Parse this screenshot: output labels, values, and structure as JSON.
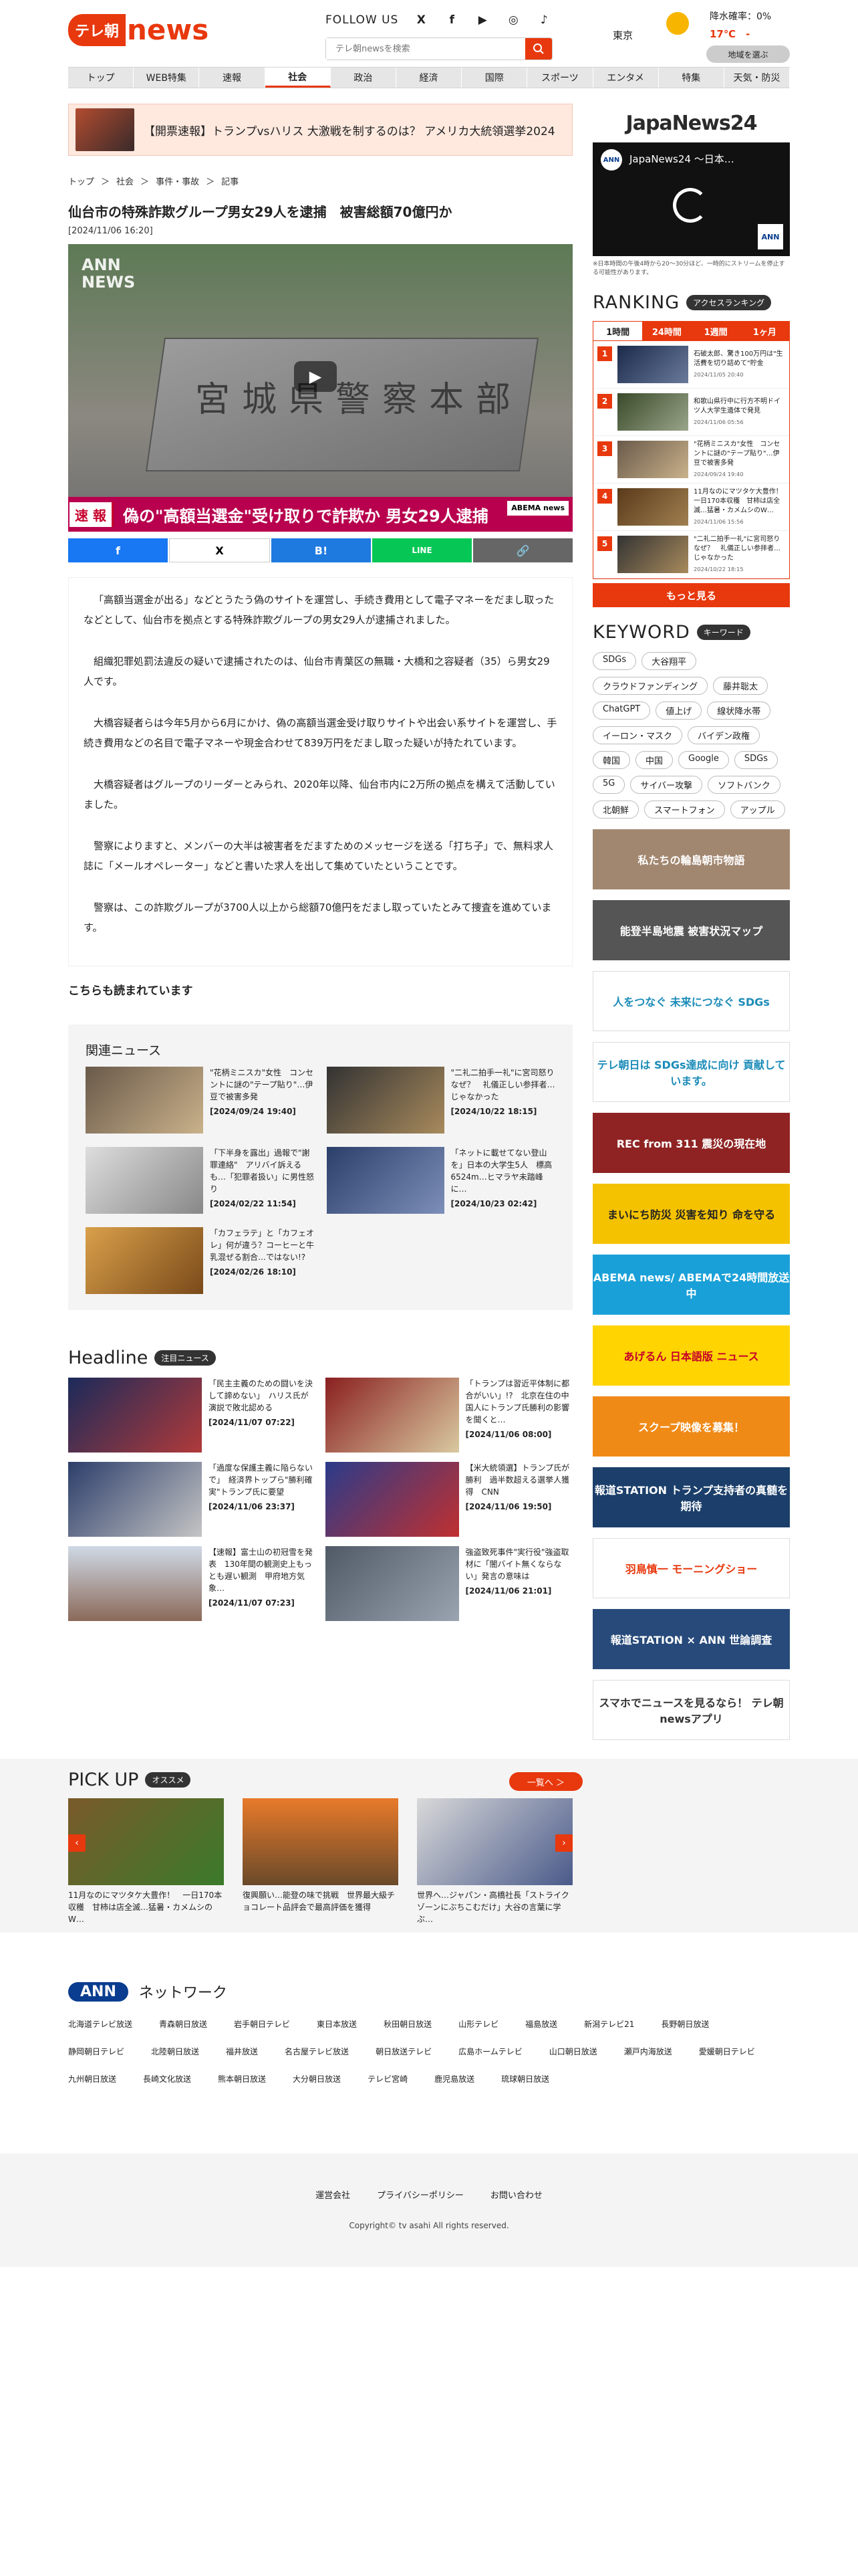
{
  "header": {
    "logo_box": "テレ朝",
    "logo_text": "news",
    "follow": "FOLLOW US",
    "social": [
      "X",
      "f",
      "▶",
      "◎",
      "♪"
    ],
    "search_placeholder": "テレ朝newsを検索",
    "weather": {
      "city": "東京",
      "rain": "降水確率：0%",
      "temp": "17℃　-",
      "button": "地域を選ぶ"
    }
  },
  "nav": [
    "トップ",
    "WEB特集",
    "速報",
    "社会",
    "政治",
    "経済",
    "国際",
    "スポーツ",
    "エンタメ",
    "特集",
    "天気・防災"
  ],
  "banner": "【開票速報】トランプvsハリス 大激戦を制するのは？ アメリカ大統領選挙2024",
  "breadcrumb": [
    "トップ",
    "＞",
    "社会",
    "＞",
    "事件・事故",
    "＞",
    "記事"
  ],
  "article": {
    "title": "仙台市の特殊詐欺グループ男女29人を逮捕　被害総額70億円か",
    "date": "[2024/11/06 16:20]",
    "video_ann": "ANN\nNEWS",
    "video_stone": "宮城県警察本部",
    "telop_badge": "速 報",
    "telop": "偽の\"高額当選金\"受け取りで詐欺か 男女29人逮捕",
    "telop_abema": "ABEMA news",
    "paragraphs": [
      "「高額当選金が出る」などとうたう偽のサイトを運営し、手続き費用として電子マネーをだまし取ったなどとして、仙台市を拠点とする特殊詐欺グループの男女29人が逮捕されました。",
      "組織犯罪処罰法違反の疑いで逮捕されたのは、仙台市青葉区の無職・大橋和之容疑者（35）ら男女29人です。",
      "大橋容疑者らは今年5月から6月にかけ、偽の高額当選金受け取りサイトや出会い系サイトを運営し、手続き費用などの名目で電子マネーや現金合わせて839万円をだまし取った疑いが持たれています。",
      "大橋容疑者はグループのリーダーとみられ、2020年以降、仙台市内に2万所の拠点を構えて活動していました。",
      "警察によりますと、メンバーの大半は被害者をだますためのメッセージを送る「打ち子」で、無料求人誌に「メールオペレーター」などと書いた求人を出して集めていたということです。",
      "警察は、この詐欺グループが3700人以上から総額70億円をだまし取っていたとみて捜査を進めています。"
    ]
  },
  "share": [
    "f",
    "X",
    "B!",
    "LINE",
    "🔗"
  ],
  "also_read": "こちらも読まれています",
  "related": {
    "title": "関連ニュース",
    "items": [
      {
        "text": "\"花柄ミニスカ\"女性　コンセントに謎の\"テープ貼り\"…伊豆で被害多発",
        "date": "[2024/09/24 19:40]"
      },
      {
        "text": "\"二礼二拍手一礼\"に宮司怒り　なぜ？　礼儀正しい参拝者…じゃなかった",
        "date": "[2024/10/22 18:15]"
      },
      {
        "text": "「下半身を露出」過報で\"謝罪連絡\"　アリバイ訴えるも…「犯罪者扱い」に男性怒り",
        "date": "[2024/02/22 11:54]"
      },
      {
        "text": "「ネットに載せてない登山を」日本の大学生5人　標高6524m…ヒマラヤ未踏峰に…",
        "date": "[2024/10/23 02:42]"
      },
      {
        "text": "「カフェラテ」と「カフェオレ」何が違う？コーヒーと牛乳混ぜる割合…ではない!?",
        "date": "[2024/02/26 18:10]"
      }
    ]
  },
  "headline": {
    "title": "Headline",
    "tag": "注目ニュース",
    "items": [
      {
        "text": "「民主主義のための闘いを決して諦めない」　ハリス氏が演説で敗北認める",
        "date": "[2024/11/07 07:22]"
      },
      {
        "text": "「トランプは習近平体制に都合がいい」!?　北京在住の中国人にトランプ氏勝利の影響を聞くと…",
        "date": "[2024/11/06 08:00]"
      },
      {
        "text": "「過度な保護主義に陥らないで」　経済界トップら\"勝利確実\"トランプ氏に要望",
        "date": "[2024/11/06 23:37]"
      },
      {
        "text": "【米大統領選】トランプ氏が勝利　過半数超える選挙人獲得　CNN",
        "date": "[2024/11/06 19:50]"
      },
      {
        "text": "【速報】富士山の初冠雪を発表　130年間の観測史上もっとも遅い観測　甲府地方気象…",
        "date": "[2024/11/07 07:23]"
      },
      {
        "text": "強盗致死事件\"実行役\"強盗取材に「闇バイト無くならない」発言の意味は",
        "date": "[2024/11/06 21:01]"
      }
    ]
  },
  "sidebar": {
    "japannews": "JapaNews24",
    "video_title": "JapaNews24 ～日本…",
    "video_note": "※日本時間の午後4時から20～30分ほど、一時的にストリームを停止する可能性があります。",
    "ranking": {
      "title": "RANKING",
      "tag": "アクセスランキング",
      "tabs": [
        "1時間",
        "24時間",
        "1週間",
        "1ヶ月"
      ],
      "items": [
        {
          "n": "1",
          "text": "石破太郎、驚き100万円は\"生活費を切り詰めて\"貯金",
          "date": "2024/11/05 20:40"
        },
        {
          "n": "2",
          "text": "和歌山県行中に行方不明ドイツ人大学生遺体で発見",
          "date": "2024/11/06 05:56"
        },
        {
          "n": "3",
          "text": "\"花柄ミニスカ\"女性　コンセントに謎の\"テープ貼り\"…伊豆で被害多発",
          "date": "2024/09/24 19:40"
        },
        {
          "n": "4",
          "text": "11月なのにマツタケ大豊作！　一日170本収穫　甘柿は店全滅…猛暑・カメムシのW…",
          "date": "2024/11/06 15:56"
        },
        {
          "n": "5",
          "text": "\"二礼二拍手一礼\"に宮司怒り　なぜ？　礼儀正しい参拝者…じゃなかった",
          "date": "2024/10/22 18:15"
        }
      ],
      "more": "もっと見る"
    },
    "keyword": {
      "title": "KEYWORD",
      "tag": "キーワード",
      "items": [
        "SDGs",
        "大谷翔平",
        "クラウドファンディング",
        "藤井聡太",
        "ChatGPT",
        "値上げ",
        "線状降水帯",
        "イーロン・マスク",
        "バイデン政権",
        "韓国",
        "中国",
        "Google",
        "SDGs",
        "5G",
        "サイバー攻撃",
        "ソフトバンク",
        "北朝鮮",
        "スマートフォン",
        "アップル"
      ]
    },
    "ads": [
      {
        "text": "私たちの輪島朝市物語",
        "bg": "#a28770",
        "fg": "#fff"
      },
      {
        "text": "能登半島地震 被害状況マップ",
        "bg": "#555",
        "fg": "#fff"
      },
      {
        "text": "人をつなぐ 未来につなぐ SDGs",
        "bg": "#fff",
        "fg": "#1a8bb8"
      },
      {
        "text": "テレ朝日は SDGs達成に向け 貢献しています。",
        "bg": "#fff",
        "fg": "#1a8bb8"
      },
      {
        "text": "REC from 311 震災の現在地",
        "bg": "#8f2323",
        "fg": "#fff"
      },
      {
        "text": "まいにち防災 災害を知り 命を守る",
        "bg": "#f5c200",
        "fg": "#222"
      },
      {
        "text": "ABEMA news/ ABEMAで24時間放送中",
        "bg": "#1aa0d8",
        "fg": "#fff"
      },
      {
        "text": "あげるん 日本語版 ニュース",
        "bg": "#ffd400",
        "fg": "#c6002c"
      },
      {
        "text": "スクープ映像を募集！",
        "bg": "#f08a17",
        "fg": "#fff"
      },
      {
        "text": "報道STATION トランプ支持者の真髄を期待",
        "bg": "#1b3f6a",
        "fg": "#fff"
      },
      {
        "text": "羽鳥慎一 モーニングショー",
        "bg": "#fff",
        "fg": "#e8380d"
      },
      {
        "text": "報道STATION × ANN 世論調査",
        "bg": "#274a7a",
        "fg": "#fff"
      },
      {
        "text": "スマホでニュースを見るなら！ テレ朝newsアプリ",
        "bg": "#fff",
        "fg": "#333"
      }
    ]
  },
  "pickup": {
    "title": "PICK UP",
    "tag": "オススメ",
    "more": "一覧へ ＞",
    "items": [
      {
        "text": "11月なのにマツタケ大豊作！　一日170本収穫　甘柿は店全滅…猛暑・カメムシのW…"
      },
      {
        "text": "復興願い…能登の味で挑戦　世界最大級チョコレート品評会で最高評価を獲得"
      },
      {
        "text": "世界へ…ジャパン・高橋社長「ストライクゾーンにぶちこむだけ」大谷の言葉に学ぶ…"
      }
    ]
  },
  "network": {
    "label": "ANN",
    "title": "ネットワーク",
    "stations": [
      "北海道テレビ放送",
      "青森朝日放送",
      "岩手朝日テレビ",
      "東日本放送",
      "秋田朝日放送",
      "山形テレビ",
      "福島放送",
      "新潟テレビ21",
      "長野朝日放送",
      "静岡朝日テレビ",
      "北陸朝日放送",
      "福井放送",
      "名古屋テレビ放送",
      "朝日放送テレビ",
      "広島ホームテレビ",
      "山口朝日放送",
      "瀬戸内海放送",
      "愛媛朝日テレビ",
      "九州朝日放送",
      "長崎文化放送",
      "熊本朝日放送",
      "大分朝日放送",
      "テレビ宮崎",
      "鹿児島放送",
      "琉球朝日放送"
    ]
  },
  "footer": {
    "links": [
      "運営会社",
      "プライバシーポリシー",
      "お問い合わせ"
    ],
    "copyright": "Copyright© tv asahi All rights reserved."
  },
  "colors": {
    "accent": "#e8380d",
    "ann_blue": "#0a3d8f"
  }
}
